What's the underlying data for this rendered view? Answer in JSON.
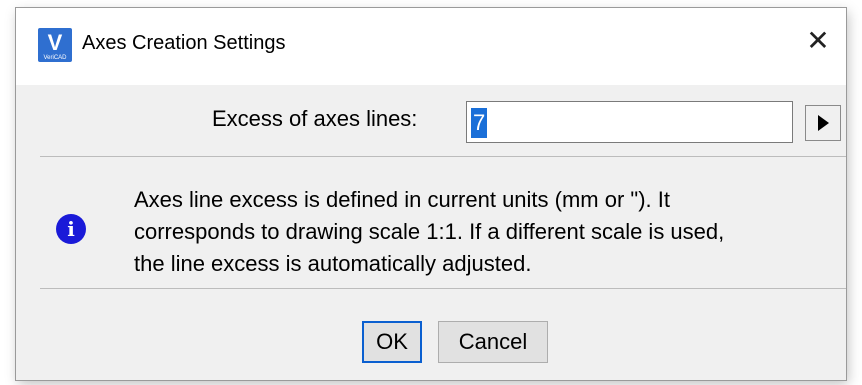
{
  "window": {
    "title": "Axes Creation Settings",
    "icon": "vericad-app-icon",
    "icon_letter": "V",
    "icon_brand": "VeriCAD",
    "close_glyph": "✕"
  },
  "field": {
    "label": "Excess of axes lines:",
    "value": "7",
    "arrow_icon": "triangle-right-icon"
  },
  "message": {
    "icon": "info-icon",
    "icon_glyph": "i",
    "lines": [
      "Axes line excess is defined in current units (mm or \"). It",
      "corresponds to drawing scale 1:1. If a different scale is used,",
      "the line excess is automatically adjusted."
    ]
  },
  "buttons": {
    "ok_label": "OK",
    "cancel_label": "Cancel"
  },
  "colors": {
    "dialog_bg": "#f0f0f0",
    "titlebar_bg": "#ffffff",
    "selection": "#1a6fd8",
    "info_icon": "#1a1ad8",
    "focus_border": "#0a5fd0"
  }
}
